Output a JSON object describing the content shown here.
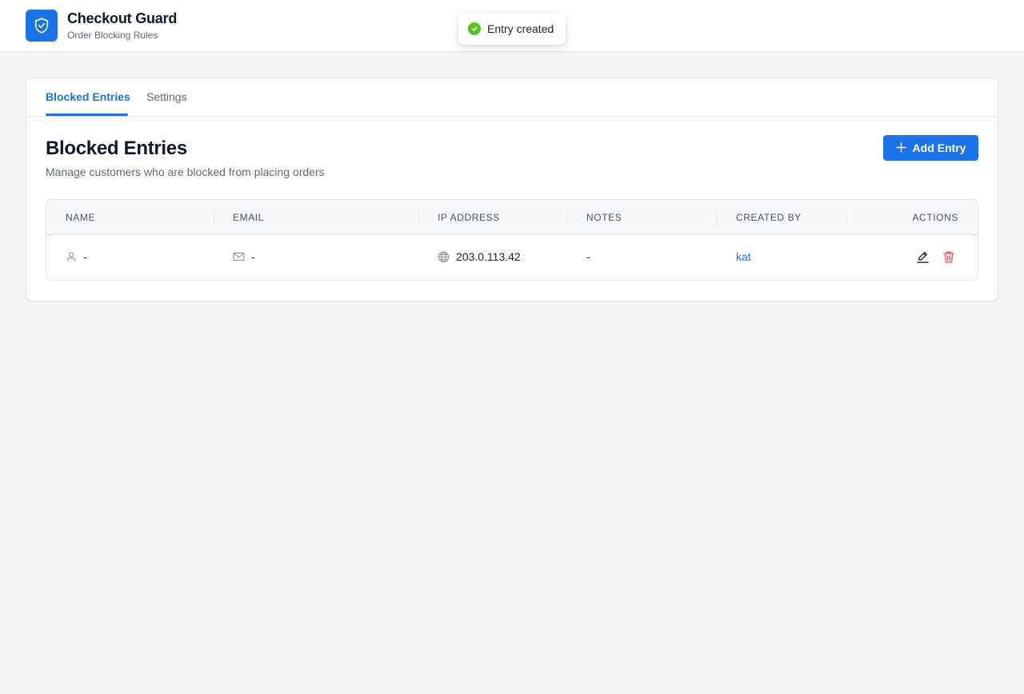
{
  "app": {
    "title": "Checkout Guard",
    "subtitle": "Order Blocking Rules",
    "logo_icon": "shield-check-icon",
    "accent_color": "#1a73e8"
  },
  "toast": {
    "message": "Entry created",
    "icon": "check-circle-icon",
    "status_color": "#52c41a"
  },
  "tabs": [
    {
      "label": "Blocked Entries",
      "active": true
    },
    {
      "label": "Settings",
      "active": false
    }
  ],
  "section": {
    "title": "Blocked Entries",
    "description": "Manage customers who are blocked from placing orders"
  },
  "add_button": {
    "label": "Add Entry",
    "icon": "plus-icon"
  },
  "table": {
    "columns": [
      "NAME",
      "EMAIL",
      "IP ADDRESS",
      "NOTES",
      "CREATED BY",
      "ACTIONS"
    ],
    "rows": [
      {
        "name": "-",
        "email": "-",
        "ip_address": "203.0.113.42",
        "notes": "-",
        "created_by": "kat",
        "actions": [
          "edit-icon",
          "trash-icon"
        ]
      }
    ]
  },
  "danger_color": "#e5484d"
}
